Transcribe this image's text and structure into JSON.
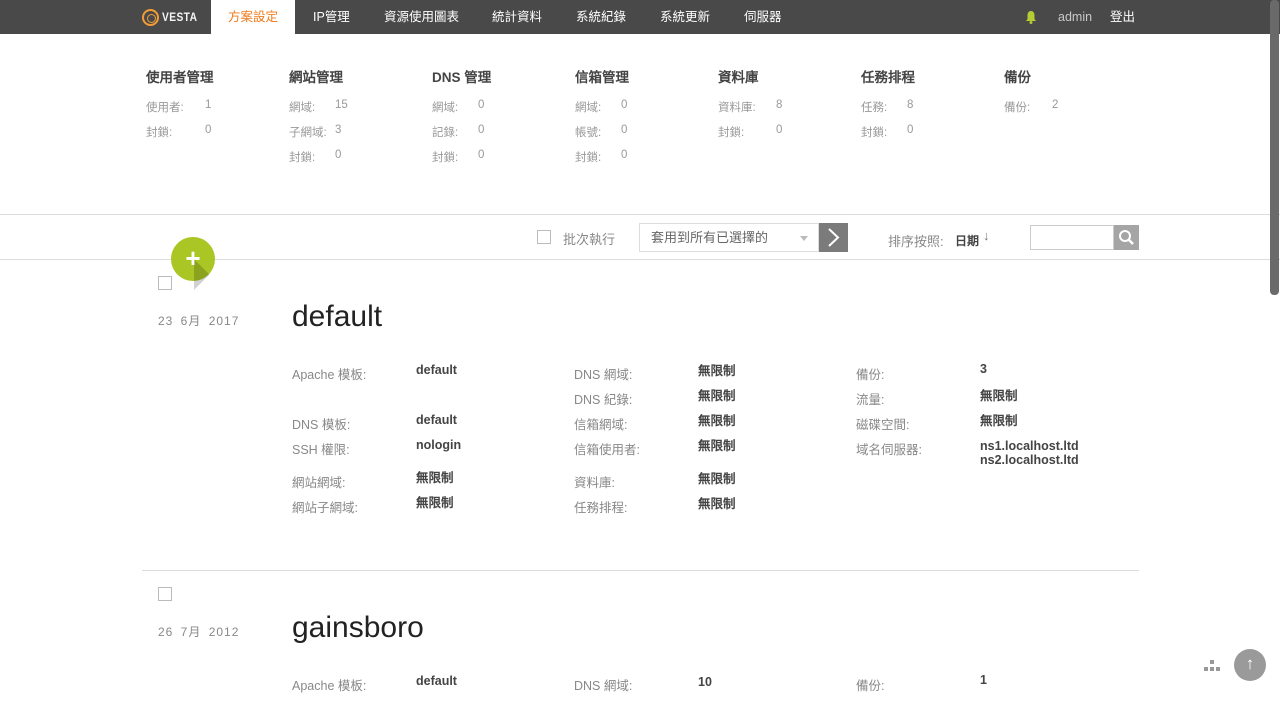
{
  "header": {
    "logo_text": "VESTA",
    "tabs": [
      "方案設定",
      "IP管理",
      "資源使用圖表",
      "統計資料",
      "系統紀錄",
      "系統更新",
      "伺服器"
    ],
    "active_tab": "方案設定",
    "user": "admin",
    "logout": "登出"
  },
  "stats": [
    {
      "title": "使用者管理",
      "rows": [
        {
          "label": "使用者:",
          "value": "1"
        },
        {
          "label": "封鎖:",
          "value": "0"
        }
      ]
    },
    {
      "title": "網站管理",
      "rows": [
        {
          "label": "網域:",
          "value": "15"
        },
        {
          "label": "子網域:",
          "value": "3"
        },
        {
          "label": "封鎖:",
          "value": "0"
        }
      ]
    },
    {
      "title": "DNS 管理",
      "rows": [
        {
          "label": "網域:",
          "value": "0"
        },
        {
          "label": "記錄:",
          "value": "0"
        },
        {
          "label": "封鎖:",
          "value": "0"
        }
      ]
    },
    {
      "title": "信箱管理",
      "rows": [
        {
          "label": "網域:",
          "value": "0"
        },
        {
          "label": "帳號:",
          "value": "0"
        },
        {
          "label": "封鎖:",
          "value": "0"
        }
      ]
    },
    {
      "title": "資料庫",
      "rows": [
        {
          "label": "資料庫:",
          "value": "8"
        },
        {
          "label": "封鎖:",
          "value": "0"
        }
      ]
    },
    {
      "title": "任務排程",
      "rows": [
        {
          "label": "任務:",
          "value": "8"
        },
        {
          "label": "封鎖:",
          "value": "0"
        }
      ]
    },
    {
      "title": "備份",
      "rows": [
        {
          "label": "備份:",
          "value": "2"
        }
      ]
    }
  ],
  "toolbar": {
    "batch_label": "批次執行",
    "apply_select": "套用到所有已選擇的",
    "sort_label": "排序按照:",
    "sort_value": "日期",
    "sort_arrow": "↓"
  },
  "add_button": "+",
  "packages": [
    {
      "date": "23 6月 2017",
      "name": "default",
      "col1": [
        {
          "label": "Apache 模板:",
          "value": "default"
        },
        {
          "label": "DNS 模板:",
          "value": "default"
        },
        {
          "label": "SSH 權限:",
          "value": "nologin"
        },
        {
          "label": "網站網域:",
          "value": "無限制"
        },
        {
          "label": "網站子網域:",
          "value": "無限制"
        }
      ],
      "col2": [
        {
          "label": "DNS 網域:",
          "value": "無限制"
        },
        {
          "label": "DNS 紀錄:",
          "value": "無限制"
        },
        {
          "label": "信箱網域:",
          "value": "無限制"
        },
        {
          "label": "信箱使用者:",
          "value": "無限制"
        },
        {
          "label": "資料庫:",
          "value": "無限制"
        },
        {
          "label": "任務排程:",
          "value": "無限制"
        }
      ],
      "col3": [
        {
          "label": "備份:",
          "value": "3"
        },
        {
          "label": "流量:",
          "value": "無限制"
        },
        {
          "label": "磁碟空間:",
          "value": "無限制"
        },
        {
          "label": "域名伺服器:",
          "value": "ns1.localhost.ltd"
        }
      ],
      "ns2": "ns2.localhost.ltd"
    },
    {
      "date": "26 7月 2012",
      "name": "gainsboro",
      "col1": [
        {
          "label": "Apache 模板:",
          "value": "default"
        }
      ],
      "col2": [
        {
          "label": "DNS 網域:",
          "value": "10"
        }
      ],
      "col3": [
        {
          "label": "備份:",
          "value": "1"
        }
      ]
    }
  ],
  "scroll_top": "↑"
}
